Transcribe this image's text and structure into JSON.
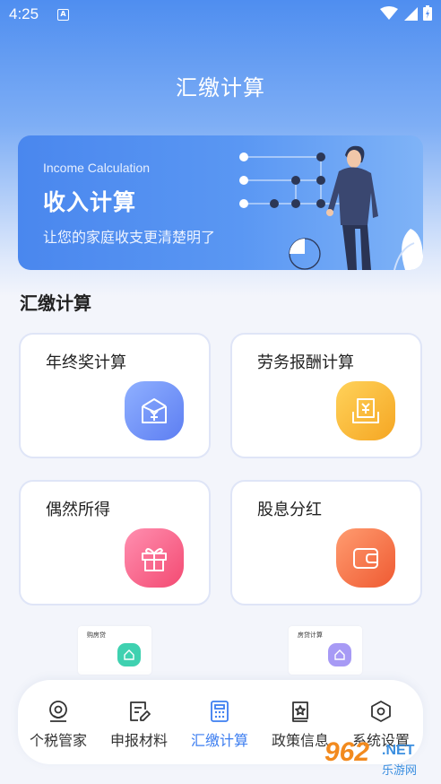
{
  "status_bar": {
    "time": "4:25",
    "notification_icon": "A"
  },
  "page_title": "汇缴计算",
  "banner": {
    "subtitle_en": "Income Calculation",
    "title": "收入计算",
    "description": "让您的家庭收支更清楚明了"
  },
  "section_title": "汇缴计算",
  "cards": [
    {
      "label": "年终奖计算",
      "icon": "envelope-yen-icon",
      "color_from": "#8fb0ff",
      "color_to": "#5d7ef2"
    },
    {
      "label": "劳务报酬计算",
      "icon": "document-yen-icon",
      "color_from": "#ffd25a",
      "color_to": "#f5a623"
    },
    {
      "label": "偶然所得",
      "icon": "gift-icon",
      "color_from": "#ff8fb0",
      "color_to": "#f34a72"
    },
    {
      "label": "股息分红",
      "icon": "wallet-icon",
      "color_from": "#ff9c70",
      "color_to": "#ef5a32"
    }
  ],
  "mini_cards": [
    {
      "label": "购房贷",
      "icon": "house-icon",
      "color": "#3fd1b0"
    },
    {
      "label": "房贷计算",
      "icon": "house-icon",
      "color": "#a79af5"
    }
  ],
  "tabbar": {
    "items": [
      {
        "label": "个税管家",
        "icon": "tax-manager-icon",
        "active": false
      },
      {
        "label": "申报材料",
        "icon": "document-edit-icon",
        "active": false
      },
      {
        "label": "汇缴计算",
        "icon": "calculator-icon",
        "active": true
      },
      {
        "label": "政策信息",
        "icon": "policy-book-icon",
        "active": false
      },
      {
        "label": "系统设置",
        "icon": "settings-hexagon-icon",
        "active": false
      }
    ]
  },
  "watermark": {
    "number": "962",
    "suffix": ".NET",
    "text": "乐游网"
  },
  "colors": {
    "accent": "#3d7ef0",
    "banner": "#4a87ee"
  }
}
